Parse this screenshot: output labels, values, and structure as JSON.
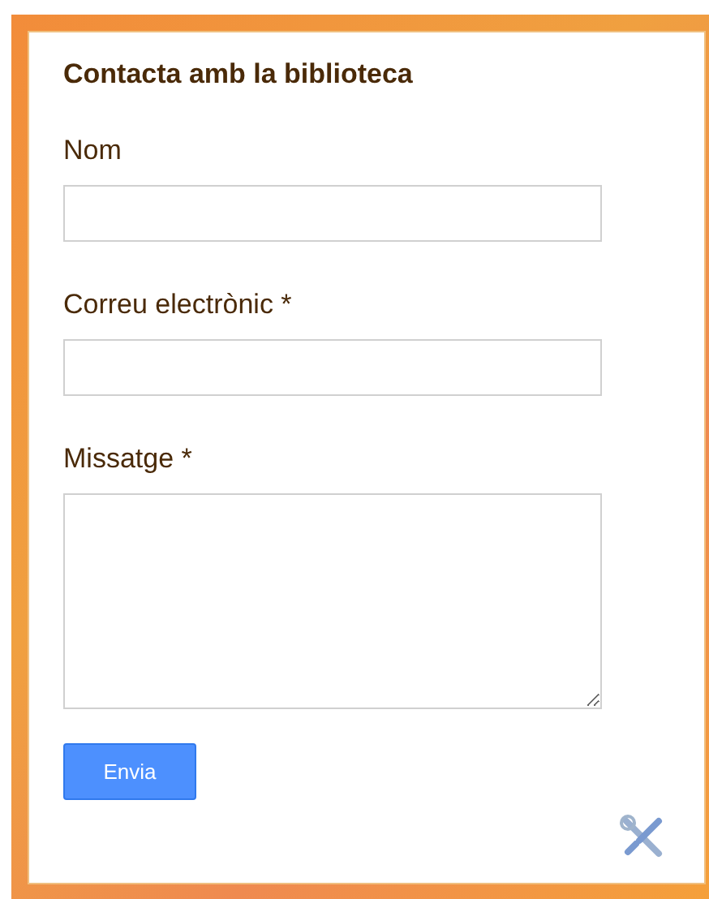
{
  "title": "Contacta amb la biblioteca",
  "fields": [
    {
      "kind": "text",
      "label": "Nom"
    },
    {
      "kind": "text",
      "label": "Correu electrònic *"
    },
    {
      "kind": "textarea",
      "label": "Missatge *"
    }
  ],
  "button": "Envia"
}
